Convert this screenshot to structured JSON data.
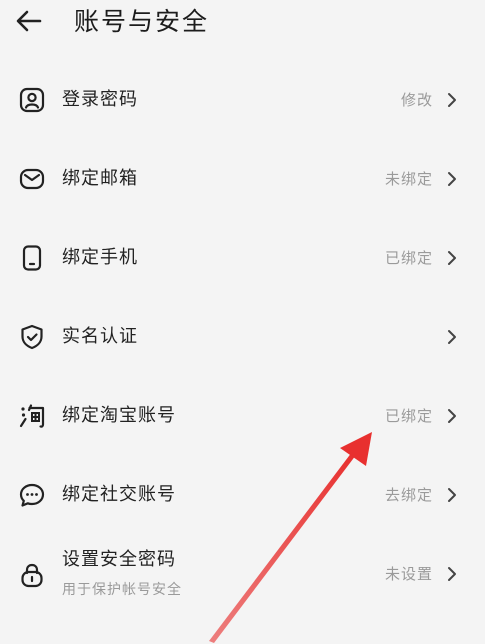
{
  "header": {
    "title": "账号与安全",
    "back_icon": "arrow-left-icon"
  },
  "rows": [
    {
      "label": "登录密码",
      "value": "修改",
      "icon": "user-frame-icon"
    },
    {
      "label": "绑定邮箱",
      "value": "未绑定",
      "icon": "mail-icon"
    },
    {
      "label": "绑定手机",
      "value": "已绑定",
      "icon": "phone-icon"
    },
    {
      "label": "实名认证",
      "value": "",
      "icon": "shield-check-icon"
    },
    {
      "label": "绑定淘宝账号",
      "value": "已绑定",
      "icon": "taobao-icon"
    },
    {
      "label": "绑定社交账号",
      "value": "去绑定",
      "icon": "chat-icon"
    },
    {
      "label": "设置安全密码",
      "sublabel": "用于保护帐号安全",
      "value": "未设置",
      "icon": "lock-icon"
    }
  ],
  "colors": {
    "background": "#f4f4f4",
    "text": "#222222",
    "muted": "#9a9a9a",
    "annotation_arrow": "#e8302f"
  }
}
